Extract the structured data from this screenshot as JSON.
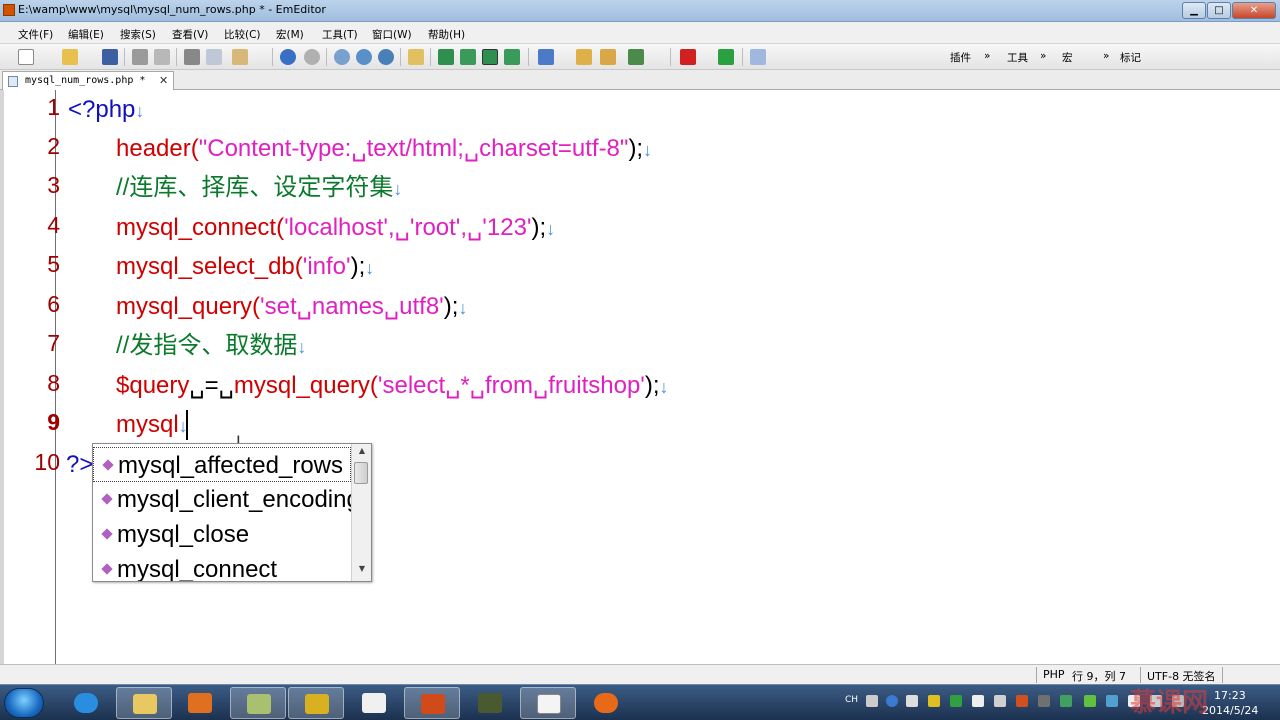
{
  "window": {
    "title": "E:\\wamp\\www\\mysql\\mysql_num_rows.php * - EmEditor",
    "min_label": "▁",
    "max_label": "□",
    "close_label": "✕"
  },
  "menu": [
    "文件(F)",
    "编辑(E)",
    "搜索(S)",
    "查看(V)",
    "比较(C)",
    "宏(M)",
    "工具(T)",
    "窗口(W)",
    "帮助(H)"
  ],
  "toolbar": {
    "plugins_label": "插件",
    "tools_label": "工具",
    "macros_label": "宏",
    "markers_label": "标记",
    "chevron": "»"
  },
  "tab": {
    "label": "mysql_num_rows.php *",
    "close": "✕"
  },
  "code": {
    "line_numbers": [
      "1",
      "2",
      "3",
      "4",
      "5",
      "6",
      "7",
      "8",
      "9",
      "10"
    ],
    "l1_tag": "<?php",
    "l2_func": "header(",
    "l2_str": "\"Content-type:␣text/html;␣charset=utf-8\"",
    "l2_end": ");",
    "l3_comment": "//连库、择库、设定字符集",
    "l4_func": "mysql_connect(",
    "l4_args": "'localhost',␣'root',␣'123'",
    "l4_end": ");",
    "l5_func": "mysql_select_db(",
    "l5_args": "'info'",
    "l5_end": ");",
    "l6_func": "mysql_query(",
    "l6_args": "'set␣names␣utf8'",
    "l6_end": ");",
    "l7_comment": "//发指令、取数据",
    "l8_var": "$query",
    "l8_op": "␣=␣",
    "l8_func": "mysql_query(",
    "l8_args": "'select␣*␣from␣fruitshop'",
    "l8_end": ");",
    "l9_text": "mysql",
    "l10_tag": "?>",
    "eol_mark": "↓"
  },
  "autocomplete": {
    "items": [
      "mysql_affected_rows",
      "mysql_client_encoding",
      "mysql_close",
      "mysql_connect"
    ],
    "selected_index": 0,
    "scroll_up": "▲",
    "scroll_down": "▼"
  },
  "status": {
    "mode": "PHP",
    "position": "行 9，列 7",
    "encoding": "UTF-8 无签名"
  },
  "taskbar": {
    "lang": "CH",
    "time": "17:23",
    "date": "2014/5/24"
  },
  "watermark": "慕课网",
  "colors": {
    "keyword": "#d00000",
    "string": "#e020c0",
    "comment": "#0b7a2c",
    "php_tag": "#1010c0",
    "line_number": "#a00000",
    "eol_mark": "#4a90d9"
  }
}
